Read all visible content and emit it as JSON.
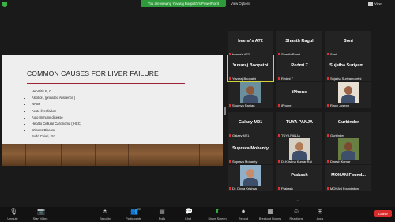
{
  "top": {
    "banner": "You are viewing Yuvaraj Boopathi's PowerPoint",
    "view_options": "View Options",
    "view": "View"
  },
  "slide": {
    "title": "COMMON CAUSES FOR LIVER FAILURE",
    "bullets": [
      "Hepatitis B, C",
      "Alcohol , (provided Abscence )",
      "NASH",
      "Acute liver failure",
      "Auto Immune disease",
      "Hepato Cellular Carcinoma ( HCC)",
      "Wilsons Disease",
      "Budd Chiari, Etc..."
    ]
  },
  "participants": [
    {
      "name": "heena's A72",
      "label": "heena's A72",
      "photo": false
    },
    {
      "name": "Shanth Ragul",
      "label": "Shanth Ragul",
      "photo": false
    },
    {
      "name": "Soni",
      "label": "Soni",
      "photo": false
    },
    {
      "name": "Yuvaraj Boopathi",
      "label": "Yuvaraj Boopathi",
      "photo": false,
      "selected": true
    },
    {
      "name": "Redmi 7",
      "label": "Redmi 7",
      "photo": false
    },
    {
      "name": "Sujatha Suriyam...",
      "label": "Sujatha Suriyamoorthi",
      "photo": false
    },
    {
      "name": "",
      "label": "Soumya Ranjan",
      "photo": true,
      "bg": "#6b8f9d",
      "skin": "#8b5a3c"
    },
    {
      "name": "iPhone",
      "label": "iPhone",
      "photo": false
    },
    {
      "name": "",
      "label": "Rincy Joseph",
      "photo": true,
      "bg": "#e7e0d2",
      "skin": "#9a6246"
    },
    {
      "name": "Galaxy M21",
      "label": "Galaxy M21",
      "photo": false
    },
    {
      "name": "TUYA PANJA",
      "label": "TUYA PANJA",
      "photo": false
    },
    {
      "name": "Gurbinder",
      "label": "Gurbinder",
      "photo": false
    },
    {
      "name": "Suprava Mohanty",
      "label": "Suprava Mohanty",
      "photo": false
    },
    {
      "name": "",
      "label": "Dr.Krishna Kumar Rai",
      "photo": true,
      "bg": "#d5d0c3",
      "skin": "#b07b55"
    },
    {
      "name": "",
      "label": "Dinesh Kumar",
      "photo": true,
      "bg": "#6a7f44",
      "skin": "#7b4a30"
    },
    {
      "name": "",
      "label": "Dr. Divya Krishna",
      "photo": true,
      "bg": "#8fb0c8",
      "skin": "#c78d6b"
    },
    {
      "name": "Prakash",
      "label": "Prakash",
      "photo": false
    },
    {
      "name": "MOHAN Found...",
      "label": "MOHAN Foundation",
      "photo": false
    }
  ],
  "toolbar": [
    {
      "label": "Unmute",
      "icon": "microphone-icon",
      "glyph": "🎙"
    },
    {
      "label": "Start Video",
      "icon": "camera-icon",
      "glyph": "📷"
    },
    {
      "label": "Security",
      "icon": "shield-icon",
      "glyph": "⛨"
    },
    {
      "label": "Participants",
      "icon": "people-icon",
      "glyph": "👥",
      "count": "22"
    },
    {
      "label": "Polls",
      "icon": "poll-icon",
      "glyph": "▤"
    },
    {
      "label": "Chat",
      "icon": "chat-icon",
      "glyph": "💬"
    },
    {
      "label": "Share Screen",
      "icon": "share-screen-icon",
      "glyph": "⬆",
      "accent": "#3cb043"
    },
    {
      "label": "Record",
      "icon": "record-icon",
      "glyph": "⏺"
    },
    {
      "label": "Breakout Rooms",
      "icon": "breakout-rooms-icon",
      "glyph": "▦"
    },
    {
      "label": "Reactions",
      "icon": "reactions-icon",
      "glyph": "☺"
    },
    {
      "label": "Apps",
      "icon": "apps-icon",
      "glyph": "⊞"
    }
  ],
  "leave": "Leave",
  "colors": {
    "share_green": "#2e9b3a",
    "leave_red": "#d92b2b",
    "selected": "#d4d23a"
  }
}
